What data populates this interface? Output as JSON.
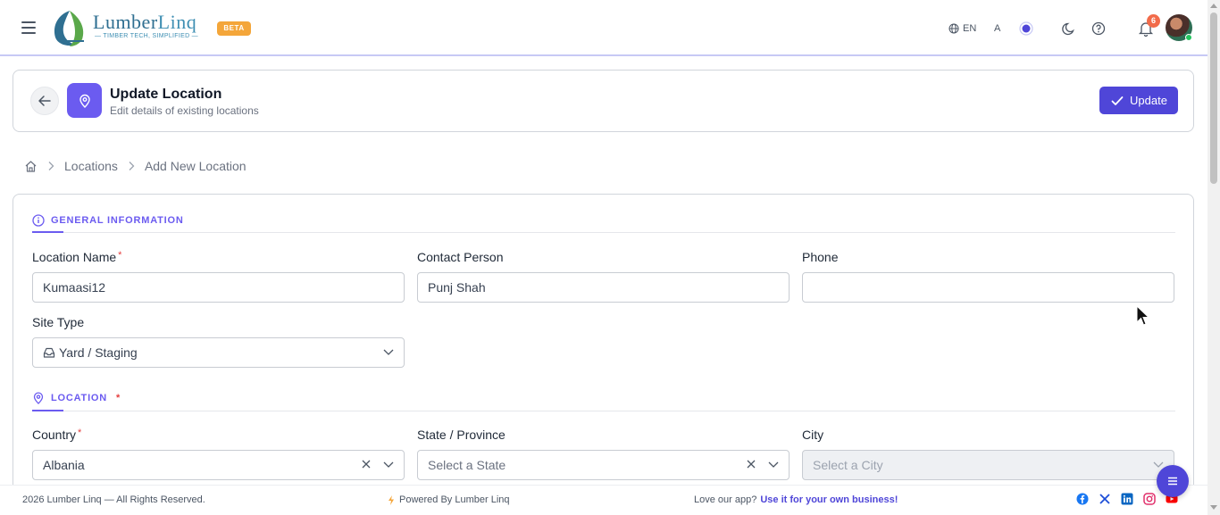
{
  "app": {
    "brand_name_1": "Lumber",
    "brand_name_2": "Linq",
    "tagline": "TIMBER TECH, SIMPLIFIED",
    "beta_label": "BETA"
  },
  "topbar": {
    "language": "EN",
    "font_toggle": "A",
    "notification_count": "6"
  },
  "header": {
    "title": "Update Location",
    "subtitle": "Edit details of existing locations",
    "update_label": "Update"
  },
  "breadcrumb": {
    "items": [
      "Locations",
      "Add New Location"
    ]
  },
  "sections": {
    "general": "GENERAL INFORMATION",
    "location": "LOCATION",
    "location_required": "*"
  },
  "fields": {
    "location_name": {
      "label": "Location Name",
      "value": "Kumaasi12",
      "required": "*"
    },
    "contact_person": {
      "label": "Contact Person",
      "value": "Punj Shah"
    },
    "phone": {
      "label": "Phone",
      "value": ""
    },
    "site_type": {
      "label": "Site Type",
      "value": "Yard / Staging"
    },
    "country": {
      "label": "Country",
      "value": "Albania",
      "required": "*"
    },
    "state": {
      "label": "State / Province",
      "placeholder": "Select a State"
    },
    "city": {
      "label": "City",
      "placeholder": "Select a City"
    }
  },
  "footer": {
    "copyright": "2026 Lumber Linq — All Rights Reserved.",
    "powered": "Powered By Lumber Linq",
    "love_text": "Love our app?",
    "love_link": "Use it for your own business!"
  },
  "colors": {
    "accent": "#6b5bf0",
    "primary_button": "#4f46d8",
    "beta_badge": "#f4a63a",
    "notification_badge": "#f26b4a",
    "required": "#e53e3e"
  },
  "icons": {
    "menu": "hamburger-icon",
    "globe": "globe-icon",
    "theme_dot": "theme-color-icon",
    "moon": "moon-icon",
    "help": "help-icon",
    "bell": "bell-icon",
    "back": "arrow-left-icon",
    "location_pin": "map-pin-icon",
    "check": "check-icon",
    "home": "home-icon",
    "info": "info-icon",
    "inbox": "inbox-icon",
    "chevron": "chevron-down-icon",
    "clear": "close-icon",
    "chat": "chat-icon"
  }
}
